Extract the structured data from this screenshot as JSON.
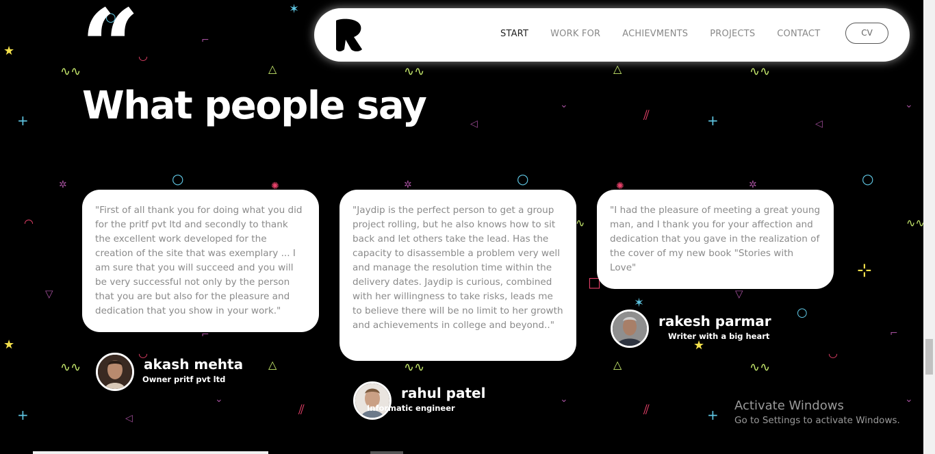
{
  "header": {
    "logo_icon": "brand-r-logo",
    "nav": [
      {
        "label": "START",
        "active": true
      },
      {
        "label": "WORK FOR",
        "active": false
      },
      {
        "label": "ACHIEVMENTS",
        "active": false
      },
      {
        "label": "PROJECTS",
        "active": false
      },
      {
        "label": "CONTACT",
        "active": false
      }
    ],
    "cv_label": "CV"
  },
  "section": {
    "quote_icon": "quote-mark-icon",
    "title": "What people say"
  },
  "testimonials": [
    {
      "text": "\"First of all thank you for doing what you did for the pritf pvt ltd and secondly to thank the excellent work developed for the creation of the site that was exemplary ... I am sure that you will succeed and you will be very successful not only by the person that you are but also for the pleasure and dedication that you show in your work.\"",
      "name": "akash mehta",
      "role": "Owner pritf pvt ltd"
    },
    {
      "text": "\"Jaydip is the perfect person to get a group project rolling, but he also knows how to sit back and let others take the lead. Has the capacity to disassemble a problem very well and manage the resolution time within the delivery dates. Jaydip is curious, combined with her willingness to take risks, leads me to believe there will be no limit to her growth and achievements in college and beyond..\"",
      "name": "rahul patel",
      "role": "Informatic engineer"
    },
    {
      "text": "\"I had the pleasure of meeting a great young man, and I thank you for your affection and dedication that you gave in the realization of the cover of my new book \"Stories with Love\"",
      "name": "rakesh parmar",
      "role": "Writer with a big heart"
    }
  ],
  "watermark": {
    "line1": "Activate Windows",
    "line2": "Go to Settings to activate Windows."
  },
  "colors": {
    "background": "#000000",
    "card": "#ffffff",
    "confetti_pink": "#e8416a",
    "confetti_green": "#c5e86c",
    "confetti_cyan": "#5fc6e3",
    "confetti_purple": "#a14e9a",
    "confetti_yellow": "#f3e04b"
  }
}
